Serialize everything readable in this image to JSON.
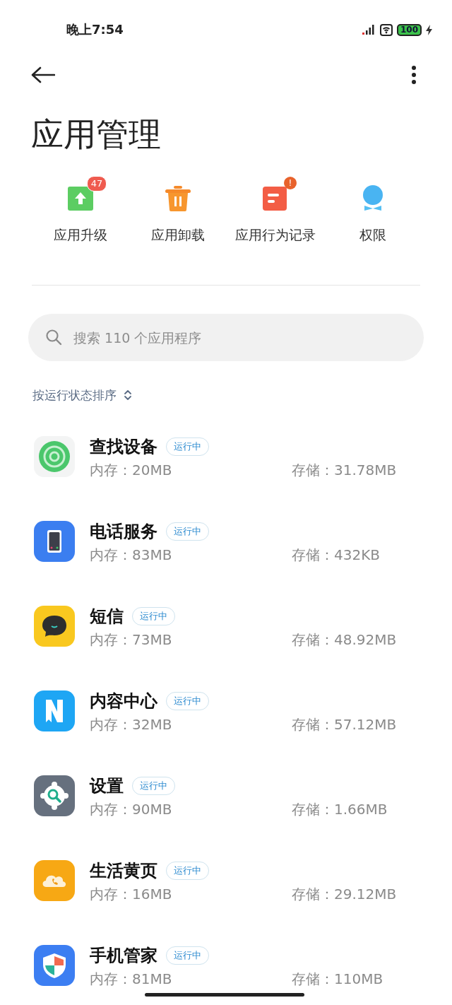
{
  "status_bar": {
    "time": "晚上7:54",
    "battery": "100"
  },
  "title": "应用管理",
  "quick_actions": [
    {
      "label": "应用升级",
      "badge": "47"
    },
    {
      "label": "应用卸载"
    },
    {
      "label": "应用行为记录",
      "badge": "!"
    },
    {
      "label": "权限"
    }
  ],
  "search": {
    "placeholder": "搜索 110 个应用程序"
  },
  "sort": {
    "label": "按运行状态排序"
  },
  "apps": [
    {
      "name": "查找设备",
      "status": "运行中",
      "memory": "内存：20MB",
      "storage": "存储：31.78MB"
    },
    {
      "name": "电话服务",
      "status": "运行中",
      "memory": "内存：83MB",
      "storage": "存储：432KB"
    },
    {
      "name": "短信",
      "status": "运行中",
      "memory": "内存：73MB",
      "storage": "存储：48.92MB"
    },
    {
      "name": "内容中心",
      "status": "运行中",
      "memory": "内存：32MB",
      "storage": "存储：57.12MB"
    },
    {
      "name": "设置",
      "status": "运行中",
      "memory": "内存：90MB",
      "storage": "存储：1.66MB"
    },
    {
      "name": "生活黄页",
      "status": "运行中",
      "memory": "内存：16MB",
      "storage": "存储：29.12MB"
    },
    {
      "name": "手机管家",
      "status": "运行中",
      "memory": "内存：81MB",
      "storage": "存储：110MB"
    }
  ]
}
